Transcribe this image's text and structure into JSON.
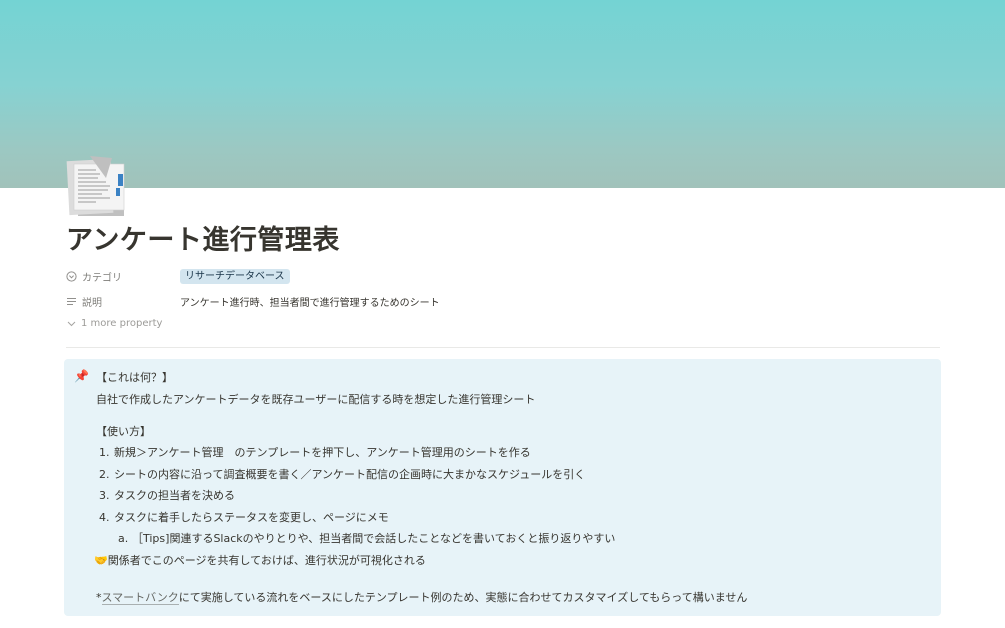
{
  "page": {
    "title": "アンケート進行管理表",
    "icon": "document-pages-icon"
  },
  "properties": [
    {
      "icon": "category-select-icon",
      "label": "カテゴリ",
      "value": "リサーチデータベース",
      "type": "tag",
      "tag_color": "#d3e5ef"
    },
    {
      "icon": "text-lines-icon",
      "label": "説明",
      "value": "アンケート進行時、担当者間で進行管理するためのシート",
      "type": "text"
    }
  ],
  "more_properties": "1 more property",
  "callout": {
    "icon": "pushpin-icon",
    "icon_glyph": "📌",
    "background": "#e7f3f8",
    "heading1": "【これは何？】",
    "desc": "自社で作成したアンケートデータを既存ユーザーに配信する時を想定した進行管理シート",
    "heading2": "【使い方】",
    "steps": [
      {
        "num": "1.",
        "text": "新規＞アンケート管理　のテンプレートを押下し、アンケート管理用のシートを作る"
      },
      {
        "num": "2.",
        "text": "シートの内容に沿って調査概要を書く／アンケート配信の企画時に大まかなスケジュールを引く"
      },
      {
        "num": "3.",
        "text": "タスクの担当者を決める"
      },
      {
        "num": "4.",
        "text": "タスクに着手したらステータスを変更し、ページにメモ"
      }
    ],
    "substep": {
      "num": "a.",
      "text": "［Tips]関連するSlackのやりとりや、担当者間で会話したことなどを書いておくと振り返りやすい"
    },
    "share_icon": "handshake-icon",
    "share_glyph": "🤝",
    "share_text": "関係者でこのページを共有しておけば、進行状況が可視化される",
    "note_prefix": "*",
    "note_link": "スマートバンク",
    "note_rest": "にて実施している流れをベースにしたテンプレート例のため、実態に合わせてカスタマイズしてもらって構いません"
  },
  "colors": {
    "text": "#37352f",
    "tag_bg": "#d3e5ef",
    "callout_bg": "#e7f3f8"
  }
}
